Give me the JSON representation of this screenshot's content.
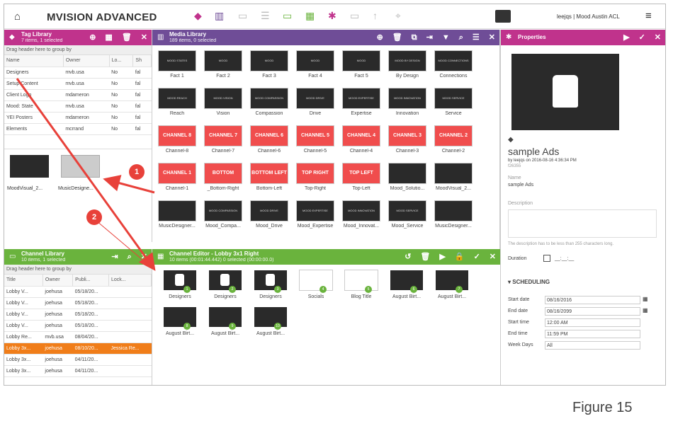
{
  "app": {
    "title": "MVISION ADVANCED",
    "user": "leejqs | Mood Austin ACL"
  },
  "tag_library": {
    "title": "Tag Library",
    "subtitle": "7 items, 1 selected",
    "group_hint": "Drag header here to group by",
    "columns": [
      "Name",
      "Owner",
      "Lo...",
      "Sh"
    ],
    "rows": [
      [
        "Designers",
        "mvb.usa",
        "No",
        "fal"
      ],
      [
        "Setup Content",
        "mvb.usa",
        "No",
        "fal"
      ],
      [
        "Client Logo",
        "mdameron",
        "No",
        "fal"
      ],
      [
        "Mood: State",
        "mvb.usa",
        "No",
        "fal"
      ],
      [
        "YEI Posters",
        "mdameron",
        "No",
        "fal"
      ],
      [
        "Elements",
        "mcrrand",
        "No",
        "fal"
      ]
    ],
    "thumbs": [
      "MoodVisual_2...",
      "MusicDesigne..."
    ]
  },
  "media_library": {
    "title": "Media Library",
    "subtitle": "189 items, 0 selected",
    "rows": [
      [
        {
          "t": "MOOD STATES",
          "l": "Fact 1"
        },
        {
          "t": "MOOD",
          "l": "Fact 2"
        },
        {
          "t": "MOOD",
          "l": "Fact 3"
        },
        {
          "t": "MOOD",
          "l": "Fact 4"
        },
        {
          "t": "MOOD",
          "l": "Fact 5"
        },
        {
          "t": "MOOD BY DESIGN",
          "l": "By Design"
        },
        {
          "t": "MOOD CONNECTIONS",
          "l": "Connections"
        }
      ],
      [
        {
          "t": "MOOD REACH",
          "l": "Reach"
        },
        {
          "t": "MOOD VISION",
          "l": "Vision"
        },
        {
          "t": "MOOD COMPASSION",
          "l": "Compassion"
        },
        {
          "t": "MOOD DRIVE",
          "l": "Drive"
        },
        {
          "t": "MOOD EXPERTISE",
          "l": "Expertise"
        },
        {
          "t": "MOOD INNOVATION",
          "l": "Innovation"
        },
        {
          "t": "MOOD SERVICE",
          "l": "Service"
        }
      ],
      [
        {
          "t": "CHANNEL 8",
          "l": "Channel-8",
          "red": true
        },
        {
          "t": "CHANNEL 7",
          "l": "Channel-7",
          "red": true
        },
        {
          "t": "CHANNEL 6",
          "l": "Channel-6",
          "red": true
        },
        {
          "t": "CHANNEL 5",
          "l": "Channel-5",
          "red": true
        },
        {
          "t": "CHANNEL 4",
          "l": "Channel-4",
          "red": true
        },
        {
          "t": "CHANNEL 3",
          "l": "Channel-3",
          "red": true
        },
        {
          "t": "CHANNEL 2",
          "l": "Channel-2",
          "red": true
        }
      ],
      [
        {
          "t": "CHANNEL 1",
          "l": "Channel-1",
          "red": true
        },
        {
          "t": "BOTTOM RIGHT",
          "l": "_Bottom-Right",
          "red": true
        },
        {
          "t": "BOTTOM LEFT",
          "l": "Bottom-Left",
          "red": true
        },
        {
          "t": "TOP RIGHT",
          "l": "Top-Right",
          "red": true
        },
        {
          "t": "TOP LEFT",
          "l": "Top-Left",
          "red": true
        },
        {
          "t": "",
          "l": "Mood_Solutio..."
        },
        {
          "t": "",
          "l": "MoodVisual_2..."
        }
      ],
      [
        {
          "t": "",
          "l": "MusicDesigner..."
        },
        {
          "t": "MOOD COMPASSION",
          "l": "Mood_Compa..."
        },
        {
          "t": "MOOD DRIVE",
          "l": "Mood_Drive"
        },
        {
          "t": "MOOD EXPERTISE",
          "l": "Mood_Expertise"
        },
        {
          "t": "MOOD INNOVATION",
          "l": "Mood_Innovat..."
        },
        {
          "t": "MOOD SERVICE",
          "l": "Mood_Service"
        },
        {
          "t": "",
          "l": "MusicDesigner..."
        }
      ]
    ]
  },
  "channel_library": {
    "title": "Channel Library",
    "subtitle": "10 items, 1 selected",
    "group_hint": "Drag header here to group by",
    "columns": [
      "Title",
      "Owner",
      "Publi...",
      "Lock..."
    ],
    "rows": [
      [
        "Lobby V...",
        "joehusa",
        "05/18/20...",
        ""
      ],
      [
        "Lobby V...",
        "joehusa",
        "05/18/20...",
        ""
      ],
      [
        "Lobby V...",
        "joehusa",
        "05/18/20...",
        ""
      ],
      [
        "Lobby V...",
        "joehusa",
        "05/18/20...",
        ""
      ],
      [
        "Lobby Re...",
        "mvb.usa",
        "08/04/20...",
        ""
      ],
      [
        "Lobby 3x...",
        "joehusa",
        "08/10/20...",
        "Jessica Re..."
      ],
      [
        "Lobby 3x...",
        "joehusa",
        "04/11/20...",
        ""
      ],
      [
        "Lobby 3x...",
        "joehusa",
        "04/11/20...",
        ""
      ]
    ],
    "selected_row": 5
  },
  "channel_editor": {
    "title": "Channel Editor - Lobby 3x1 Right",
    "subtitle": "10 items (00:01:44.442) 0 selected (00:00:00.0)",
    "items": [
      {
        "n": "1",
        "l": "Designers",
        "type": "tag"
      },
      {
        "n": "2",
        "l": "Designers",
        "type": "tag"
      },
      {
        "n": "3",
        "l": "Designers",
        "type": "tag"
      },
      {
        "n": "4",
        "l": "Socials",
        "type": "logo"
      },
      {
        "n": "5",
        "l": "Blog Title",
        "type": "logo"
      },
      {
        "n": "6",
        "l": "August Birt...",
        "type": "cake"
      },
      {
        "n": "7",
        "l": "August Birt...",
        "type": "cake"
      },
      {
        "n": "8",
        "l": "August Birt...",
        "type": "cake"
      },
      {
        "n": "9",
        "l": "August Birt...",
        "type": "cake"
      },
      {
        "n": "10",
        "l": "August Birt...",
        "type": "cake"
      }
    ]
  },
  "properties": {
    "title": "Properties",
    "asset_name": "sample Ads",
    "byline": "by leejqs on 2016-08-16 4:36:34 PM",
    "id": "f26355",
    "name_label": "Name",
    "name_value": "sample Ads",
    "desc_label": "Description",
    "desc_hint": "The description has to be less than 255 characters long.",
    "duration_label": "Duration",
    "duration_value": "__:__:__",
    "scheduling_label": "SCHEDULING",
    "schedule": [
      {
        "l": "Start date",
        "v": "08/16/2016",
        "cal": true
      },
      {
        "l": "End date",
        "v": "08/16/2099",
        "cal": true
      },
      {
        "l": "Start time",
        "v": "12:00 AM",
        "cal": false
      },
      {
        "l": "End time",
        "v": "11:59 PM",
        "cal": false
      },
      {
        "l": "Week Days",
        "v": "All",
        "cal": false
      }
    ]
  },
  "callouts": [
    "1",
    "2"
  ],
  "caption": "Figure 15",
  "colors": {
    "tag": "#c0338c",
    "media": "#6f4d97",
    "channel": "#6ab33d",
    "selected": "#f07d19",
    "arrow": "#e8413a"
  }
}
